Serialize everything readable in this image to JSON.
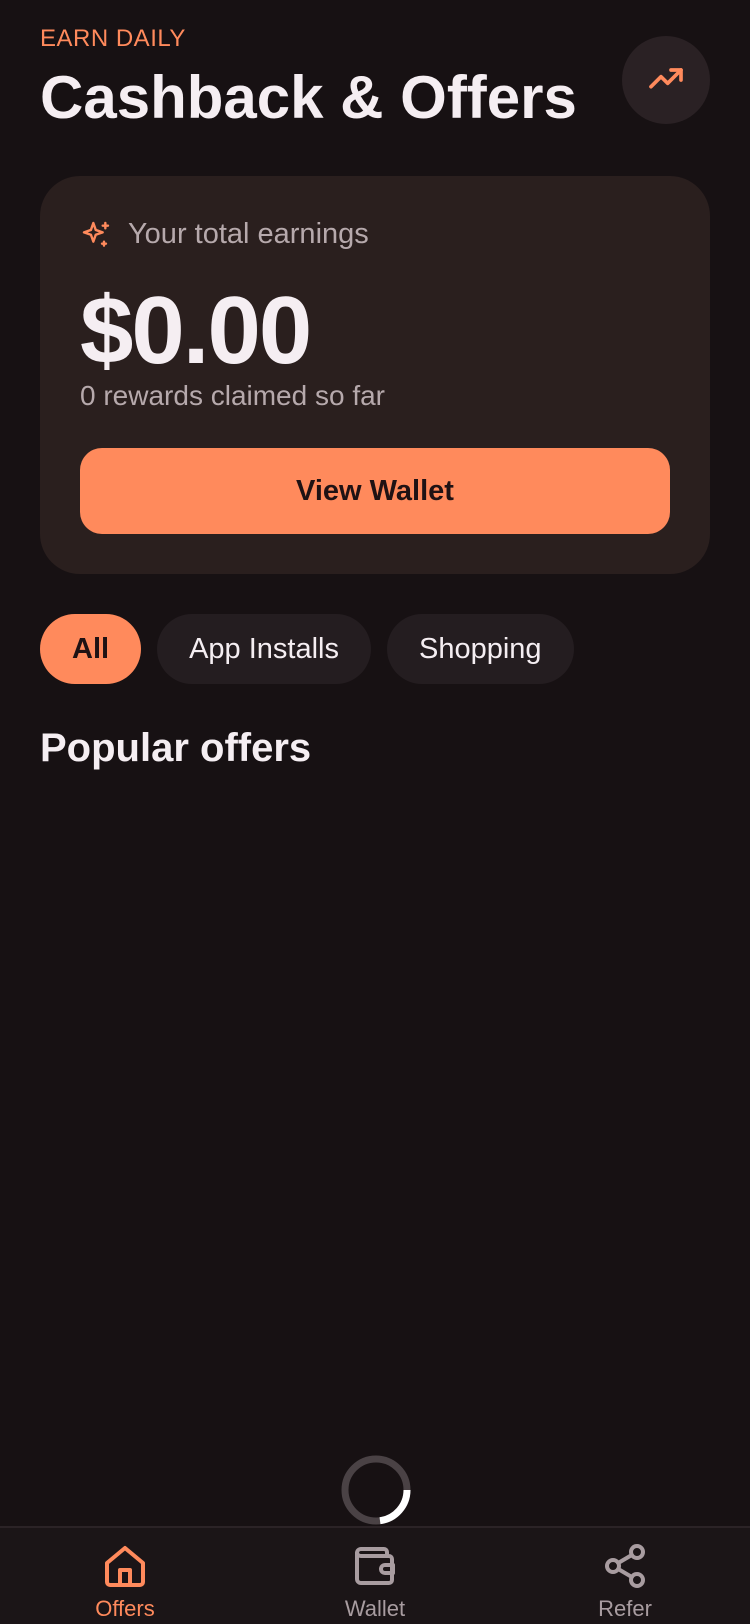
{
  "header": {
    "eyebrow": "EARN DAILY",
    "title": "Cashback & Offers",
    "action_icon": "trending-up-icon"
  },
  "earnings_card": {
    "icon": "sparkle-icon",
    "label": "Your total earnings",
    "amount": "$0.00",
    "subtitle": "0 rewards claimed so far",
    "button_label": "View Wallet"
  },
  "filters": {
    "selected": "All",
    "items": [
      "All",
      "App Installs",
      "Shopping"
    ]
  },
  "section": {
    "title": "Popular offers"
  },
  "bottom_nav": {
    "active": "Offers",
    "items": [
      {
        "label": "Offers",
        "icon": "home-icon"
      },
      {
        "label": "Wallet",
        "icon": "wallet-icon"
      },
      {
        "label": "Refer",
        "icon": "share-icon"
      }
    ]
  },
  "colors": {
    "background": "#171113",
    "accent": "#ff8a5c",
    "card": "#2a1f1e",
    "chip": "#241d20",
    "text_primary": "#f5eef2",
    "text_secondary": "#b6a9ac"
  }
}
